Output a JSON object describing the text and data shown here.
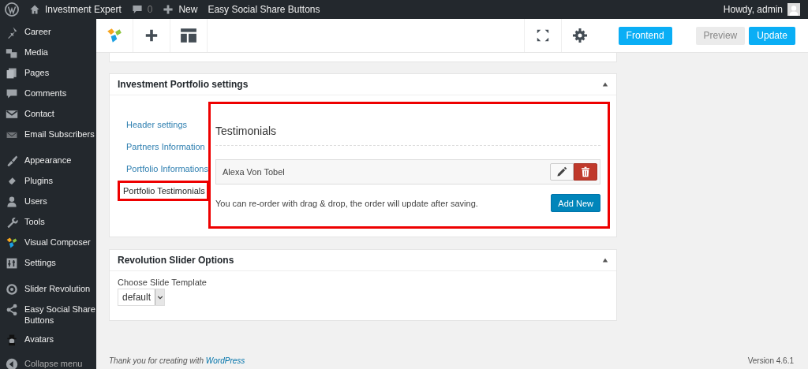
{
  "admin_bar": {
    "site": "Investment Expert",
    "comments": "0",
    "new": "New",
    "plugin": "Easy Social Share Buttons",
    "greeting": "Howdy, admin"
  },
  "sidebar": {
    "groups": [
      {
        "items": [
          "Career",
          "Media",
          "Pages",
          "Comments",
          "Contact",
          "Email Subscribers"
        ]
      },
      {
        "items": [
          "Appearance",
          "Plugins",
          "Users",
          "Tools",
          "Visual Composer",
          "Settings"
        ]
      },
      {
        "items": [
          "Slider Revolution",
          "Easy Social Share Buttons",
          "Avatars"
        ]
      }
    ],
    "collapse": "Collapse menu"
  },
  "toolbar": {
    "buttons": [
      {
        "label": "Frontend",
        "kind": "primary"
      },
      {
        "label": "Preview",
        "kind": "secondary"
      },
      {
        "label": "Update",
        "kind": "primary"
      }
    ]
  },
  "portfolio_panel": {
    "title": "Investment Portfolio settings",
    "tabs": [
      {
        "label": "Header settings",
        "selected": false,
        "highlighted": false
      },
      {
        "label": "Partners Information",
        "selected": false,
        "highlighted": false
      },
      {
        "label": "Portfolio Informations",
        "selected": false,
        "highlighted": false
      },
      {
        "label": "Portfolio Testimonials",
        "selected": true,
        "highlighted": true
      }
    ],
    "content": {
      "highlighted": true,
      "heading": "Testimonials",
      "items": [
        "Alexa Von Tobel"
      ],
      "hint": "You can re-order with drag & drop, the order will update after saving.",
      "add_button": "Add New"
    }
  },
  "slider_panel": {
    "title": "Revolution Slider Options",
    "field_label": "Choose Slide Template",
    "select_value": "default"
  },
  "footer": {
    "thanks": "Thank you for creating with ",
    "link": "WordPress",
    "version": "Version 4.6.1"
  }
}
